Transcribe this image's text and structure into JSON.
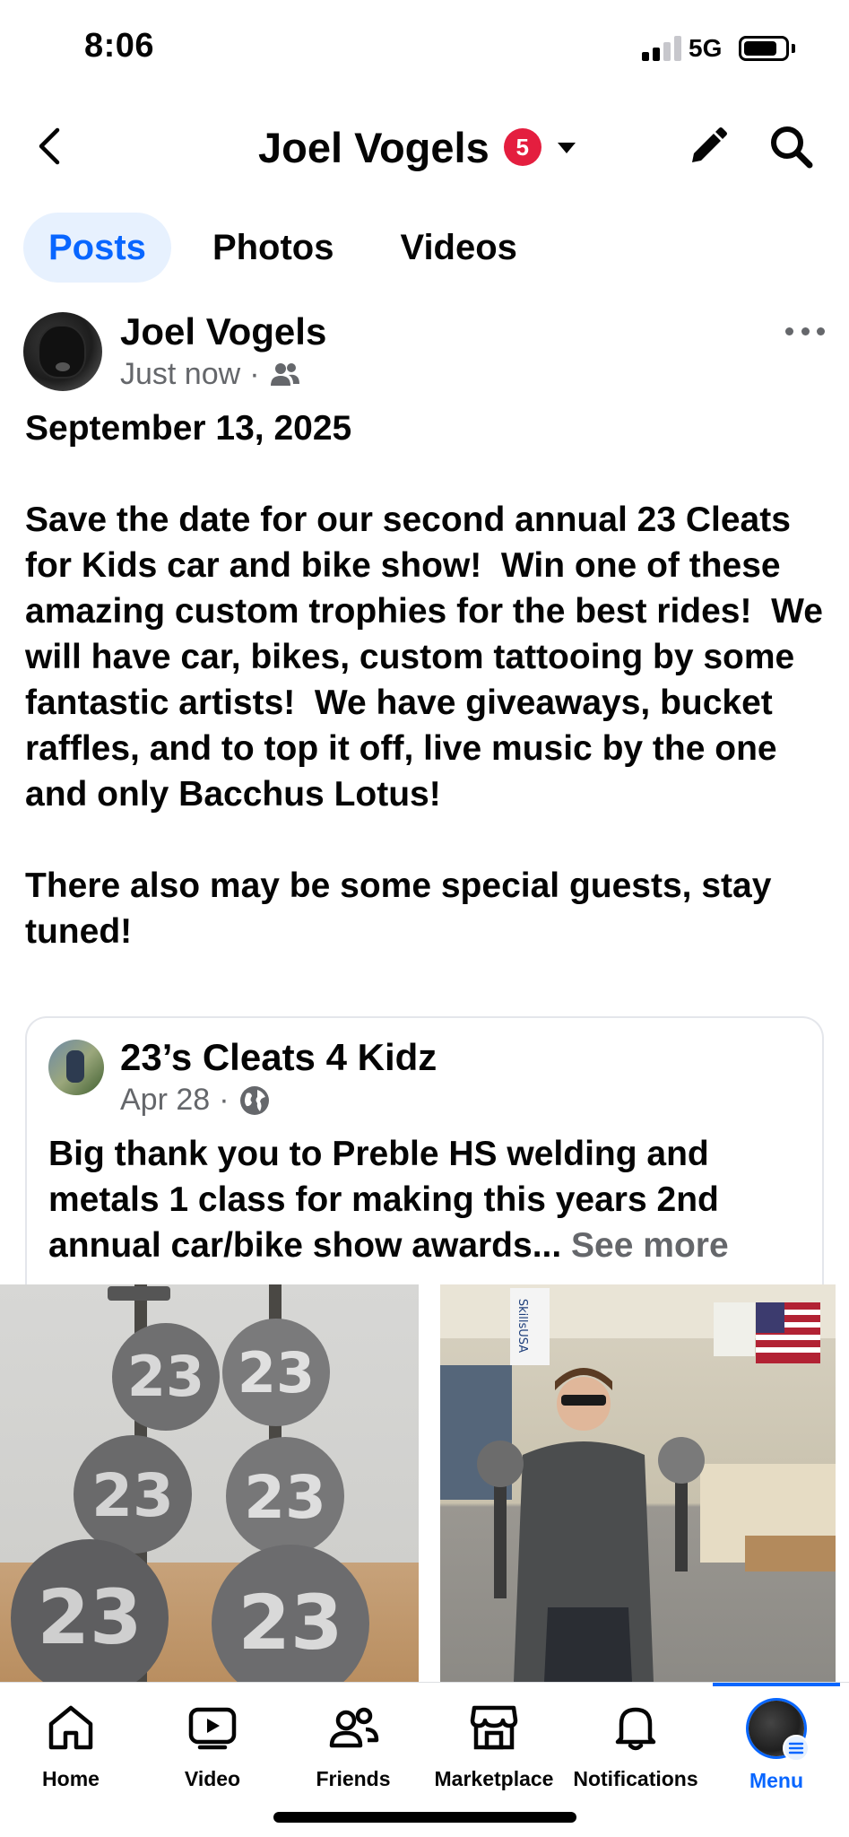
{
  "status_bar": {
    "time": "8:06",
    "network": "5G"
  },
  "header": {
    "title": "Joel Vogels",
    "badge_count": "5"
  },
  "tabs": [
    {
      "label": "Posts",
      "active": true
    },
    {
      "label": "Photos",
      "active": false
    },
    {
      "label": "Videos",
      "active": false
    }
  ],
  "post": {
    "author": "Joel Vogels",
    "time": "Just now",
    "audience_icon": "friends-icon",
    "text": "September 13, 2025\n\nSave the date for our second annual 23 Cleats for Kids car and bike show!  Win one of these amazing custom trophies for the best rides!  We will have car, bikes, custom tattooing by some fantastic artists!  We have giveaways, bucket raffles, and to top it off, live music by the one and only Bacchus Lotus!\n\nThere also may be some special guests, stay tuned!",
    "shared": {
      "author": "23’s Cleats 4 Kidz",
      "date": "Apr 28",
      "audience_icon": "globe-icon",
      "text": "Big thank you to Preble HS welding and metals 1 class for making this years 2nd annual car/bike show awards...",
      "see_more": "See more"
    }
  },
  "photos": {
    "left_badge": "23",
    "right_banner": "SkillsUSA"
  },
  "bottom_nav": [
    {
      "label": "Home",
      "icon": "home-icon",
      "active": false
    },
    {
      "label": "Video",
      "icon": "video-icon",
      "active": false
    },
    {
      "label": "Friends",
      "icon": "friends-icon",
      "active": false
    },
    {
      "label": "Marketplace",
      "icon": "marketplace-icon",
      "active": false
    },
    {
      "label": "Notifications",
      "icon": "bell-icon",
      "active": false
    },
    {
      "label": "Menu",
      "icon": "menu-avatar",
      "active": true
    }
  ],
  "colors": {
    "accent": "#0866ff",
    "badge": "#e41e3f",
    "secondary_text": "#65676b"
  }
}
